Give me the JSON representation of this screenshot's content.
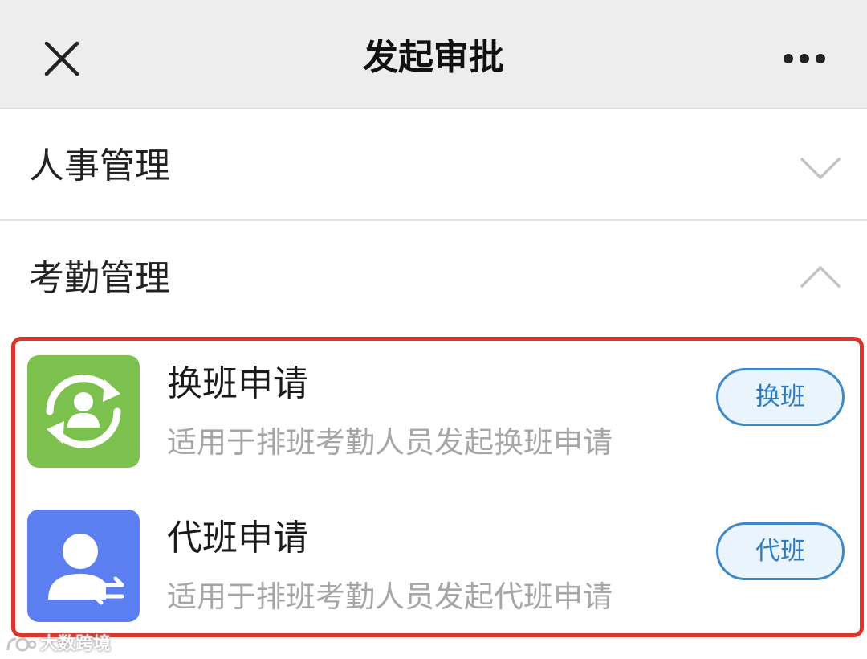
{
  "header": {
    "title": "发起审批",
    "close_icon": "close-icon",
    "more_icon": "more-dots-icon"
  },
  "sections": [
    {
      "title": "人事管理",
      "expanded": false,
      "chevron_icon": "chevron-down-icon"
    },
    {
      "title": "考勤管理",
      "expanded": true,
      "chevron_icon": "chevron-up-icon"
    }
  ],
  "items": [
    {
      "title": "换班申请",
      "description": "适用于排班考勤人员发起换班申请",
      "button": "换班",
      "icon": "shift-swap-icon",
      "icon_color": "#7cc14d"
    },
    {
      "title": "代班申请",
      "description": "适用于排班考勤人员发起代班申请",
      "button": "代班",
      "icon": "shift-cover-icon",
      "icon_color": "#5b7ef0"
    }
  ],
  "watermark": {
    "text": "大数跨境"
  },
  "colors": {
    "navbar_bg": "#ededed",
    "highlight_border": "#d9372a",
    "button_border": "#3d89c9",
    "button_text": "#2f7dc0",
    "button_bg": "#eaf4fc"
  }
}
